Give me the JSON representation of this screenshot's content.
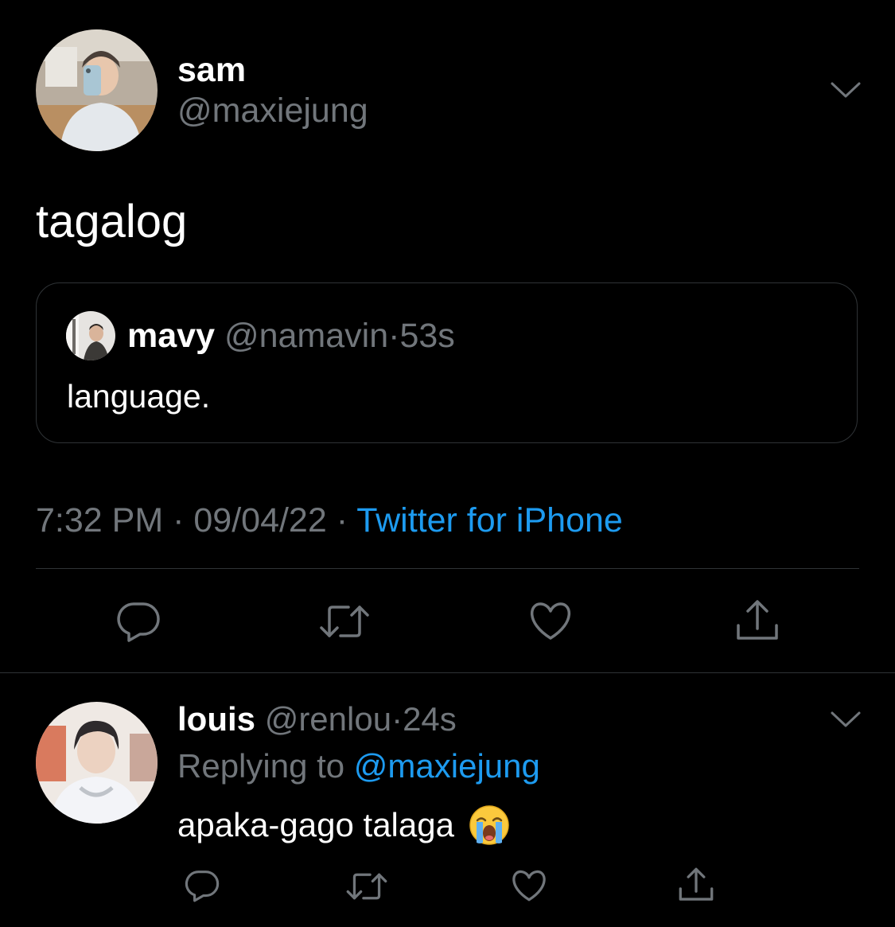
{
  "main_tweet": {
    "author_name": "sam",
    "author_handle": "@maxiejung",
    "text": "tagalog",
    "avatar_icon": "user-avatar-icon"
  },
  "quoted_tweet": {
    "author_name": "mavy",
    "author_handle": "@namavin",
    "separator": "·",
    "time": "53s",
    "text": "language."
  },
  "meta": {
    "time": "7:32 PM",
    "separator": "·",
    "date": "09/04/22",
    "source": "Twitter for iPhone"
  },
  "actions": {
    "icons": [
      "reply-icon",
      "retweet-icon",
      "like-icon",
      "share-icon"
    ]
  },
  "reply": {
    "author_name": "louis",
    "author_handle": "@renlou",
    "separator": "·",
    "time": "24s",
    "replying_to_label": "Replying to",
    "replying_to_handle": "@maxiejung",
    "text": "apaka-gago talaga",
    "emoji": "loudly-crying-face-emoji"
  },
  "colors": {
    "background": "#000000",
    "primary_text": "#ffffff",
    "secondary_text": "#71767b",
    "accent": "#1d9bf0",
    "border": "#2f3336"
  }
}
